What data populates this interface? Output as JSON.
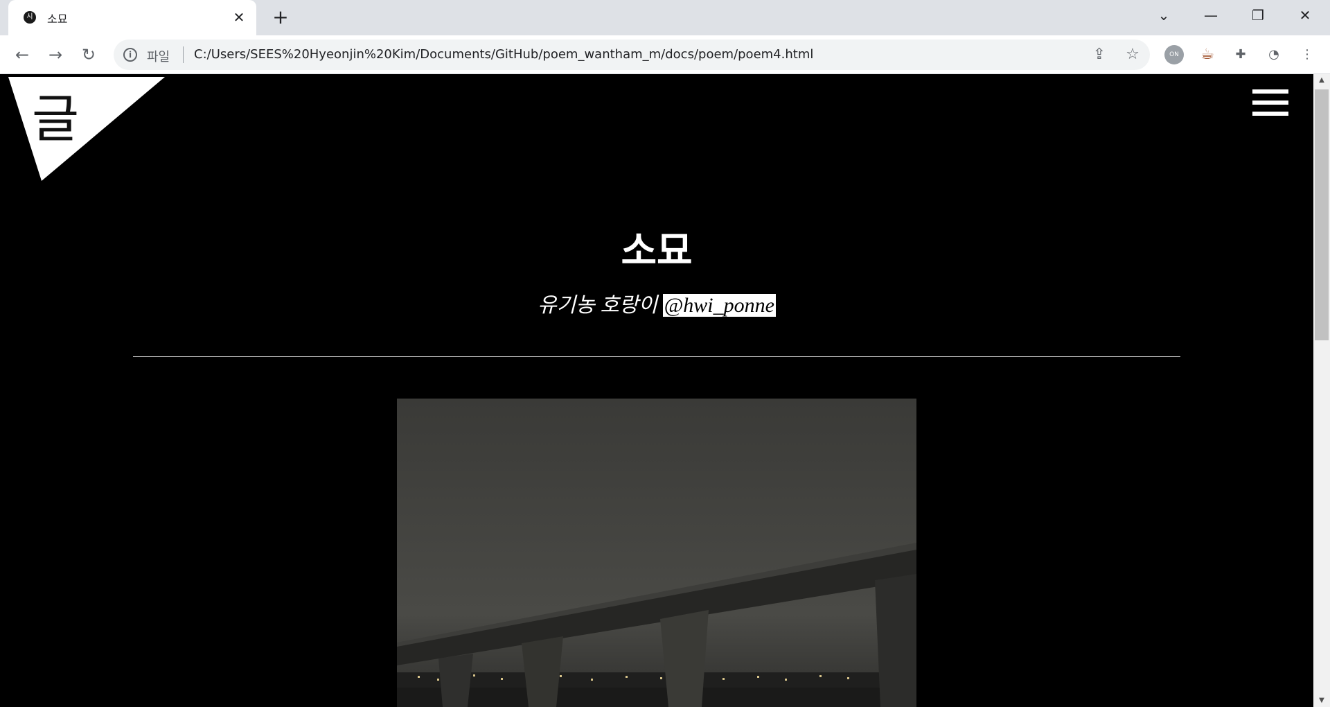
{
  "browser": {
    "tab": {
      "favicon": "시",
      "title": "소묘",
      "close_icon": "✕"
    },
    "new_tab_icon": "+",
    "window_controls": {
      "tab_search": "⌄",
      "minimize": "—",
      "restore": "❐",
      "close": "✕"
    },
    "nav": {
      "back": "←",
      "forward": "→",
      "reload": "↻"
    },
    "address_bar": {
      "info_icon": "i",
      "scheme_label": "파일",
      "url": "C:/Users/SEES%20Hyeonjin%20Kim/Documents/GitHub/poem_wantham_m/docs/poem/poem4.html",
      "share_icon": "⇪",
      "bookmark_icon": "☆"
    },
    "extensions": {
      "ext1": "ON",
      "ext2": "☕",
      "puzzle": "✚",
      "profile": "◔",
      "menu": "⋮"
    }
  },
  "page": {
    "logo_text": "글",
    "menu_icon": "hamburger-icon",
    "title": "소묘",
    "author": {
      "name": "유기농 호랑이",
      "handle": "@hwi_ponne"
    },
    "photo": "night-bridge-river-photo"
  },
  "scrollbar": {
    "up": "▲",
    "down": "▼",
    "position": 0
  }
}
